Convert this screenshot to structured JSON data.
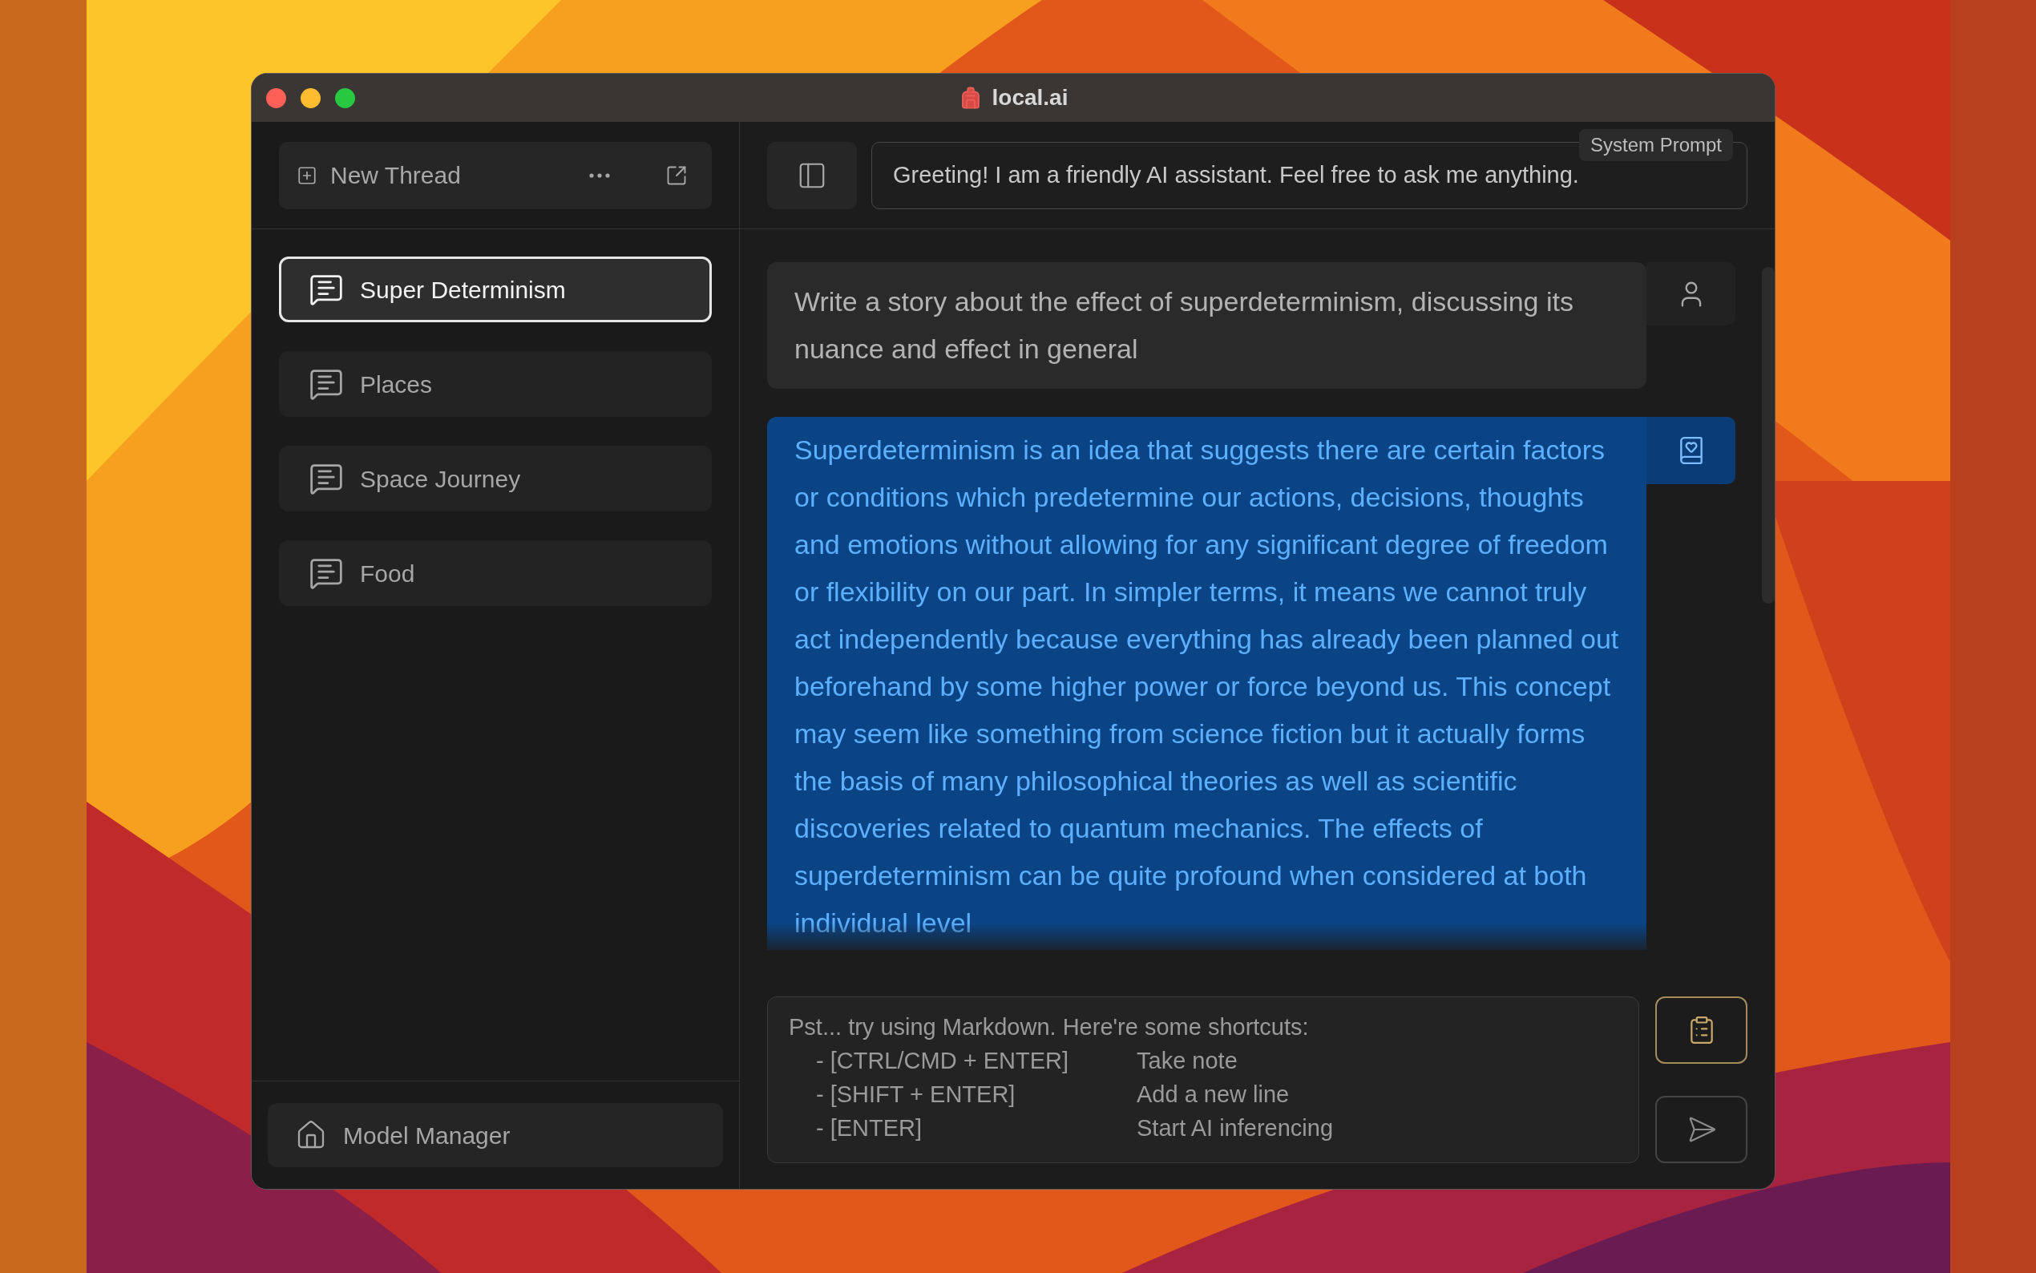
{
  "window": {
    "title": "local.ai"
  },
  "sidebar": {
    "new_thread": {
      "label": "New Thread"
    },
    "threads": [
      {
        "title": "Super Determinism",
        "selected": true
      },
      {
        "title": "Places",
        "selected": false
      },
      {
        "title": "Space Journey",
        "selected": false
      },
      {
        "title": "Food",
        "selected": false
      }
    ],
    "footer": {
      "label": "Model Manager"
    }
  },
  "header": {
    "system_prompt": {
      "label": "System Prompt",
      "value": "Greeting! I am a friendly AI assistant. Feel free to ask me anything."
    }
  },
  "messages": [
    {
      "kind": "user",
      "text": "Write a story about the effect of superdeterminism, discussing its nuance and effect in general"
    },
    {
      "kind": "assistant",
      "text": "Superdeterminism is an idea that suggests there are certain factors or conditions which predetermine our actions, decisions, thoughts and emotions without allowing for any significant degree of freedom or flexibility on our part. In simpler terms, it means we cannot truly act independently because everything has already been planned out beforehand by some higher power or force beyond us. This concept may seem like something from science fiction but it actually forms the basis of many philosophical theories as well as scientific discoveries related to quantum mechanics. The effects of superdeterminism can be quite profound when considered at both individual level"
    }
  ],
  "composer": {
    "placeholder": "Pst... try using Markdown. Here're some shortcuts:",
    "shortcuts": [
      {
        "keys": "- [CTRL/CMD + ENTER]",
        "action": "Take note"
      },
      {
        "keys": "- [SHIFT + ENTER]",
        "action": "Add a new line"
      },
      {
        "keys": "- [ENTER]",
        "action": "Start AI inferencing"
      }
    ]
  }
}
